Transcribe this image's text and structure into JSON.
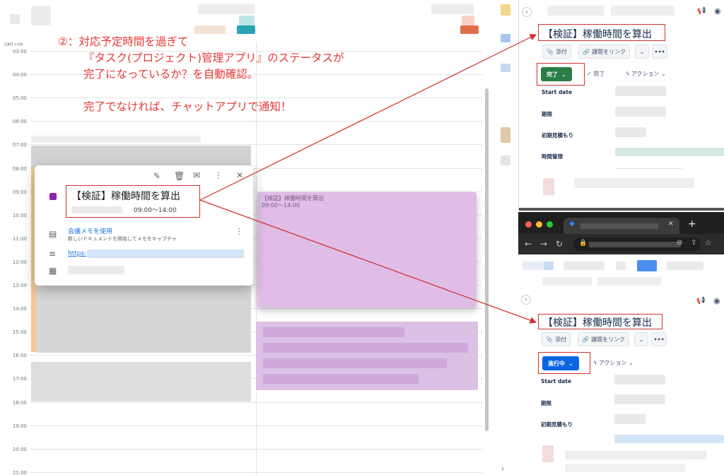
{
  "annotation": {
    "lines": [
      "②：対応予定時間を過ぎて",
      "『タスク(プロジェクト)管理アプリ』のステータスが",
      "完了になっているか？を自動確認。",
      "",
      "完了でなければ、チャットアプリで通知！"
    ]
  },
  "calendar": {
    "timezone": "GMT+09",
    "hours": [
      "03:00",
      "04:00",
      "05:00",
      "06:00",
      "07:00",
      "08:00",
      "09:00",
      "10:00",
      "11:00",
      "12:00",
      "13:00",
      "14:00",
      "15:00",
      "16:00",
      "17:00",
      "18:00",
      "19:00",
      "20:00",
      "21:00"
    ],
    "event": {
      "title": "【検証】稼働時間を算出",
      "time": "09:00〜14:00"
    },
    "popup": {
      "title": "【検証】稼働時間を算出",
      "time": "09:00〜14:00",
      "meet_label": "会議メモを使用",
      "meet_desc": "新しいドキュメントを開始してメモをキャプチャ",
      "link_text": "https:",
      "color": "#8e24aa",
      "icons": [
        "edit-icon",
        "delete-icon",
        "email-icon",
        "more-icon",
        "close-icon",
        "document-icon",
        "description-icon",
        "calendar-icon"
      ]
    }
  },
  "task_panel_done": {
    "title": "【検証】稼働時間を算出",
    "attach_label": "添付",
    "link_issue_label": "課題をリンク",
    "status_label": "完了",
    "status_check_label": "完了",
    "action_label": "アクション",
    "fields": [
      "Start date",
      "期限",
      "初期見積もり",
      "時間管理"
    ],
    "status_color": "#2a7d46"
  },
  "task_panel_progress": {
    "title": "【検証】稼働時間を算出",
    "attach_label": "添付",
    "link_issue_label": "課題をリンク",
    "status_label": "進行中",
    "action_label": "アクション",
    "fields": [
      "Start date",
      "期限",
      "初期見積もり"
    ],
    "status_color": "#0b66e4"
  },
  "accent_red": "#d0312d"
}
